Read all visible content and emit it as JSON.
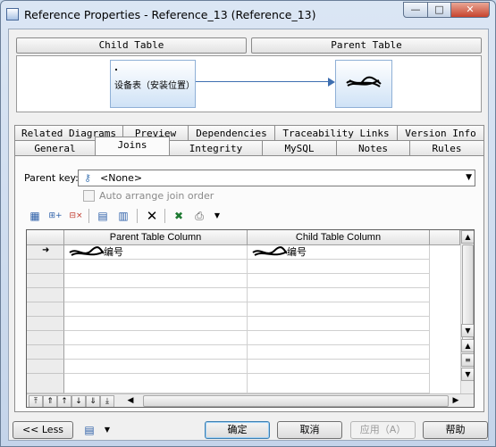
{
  "window": {
    "title": "Reference Properties - Reference_13 (Reference_13)",
    "controls": {
      "minimize": "—",
      "maximize": "□",
      "close": "✕"
    }
  },
  "header_buttons": {
    "child_table": "Child Table",
    "parent_table": "Parent Table"
  },
  "diagram": {
    "child_entity_label": "设备表（安装位置）",
    "parent_entity_label": "",
    "line_color": "#3f6fb0"
  },
  "tabs": {
    "row_back": [
      "Related Diagrams",
      "Preview",
      "Dependencies",
      "Traceability Links",
      "Version Info"
    ],
    "row_front": [
      "General",
      "Joins",
      "Integrity",
      "MySQL",
      "Notes",
      "Rules"
    ],
    "active": "Joins"
  },
  "joins": {
    "parent_key_label": "Parent key:",
    "parent_key_value": "<None>",
    "auto_arrange_label": "Auto arrange join order",
    "auto_arrange_checked": false,
    "toolbar_icons": [
      "insert-row-icon",
      "add-row-icon",
      "delete-rows-icon",
      "reuse-columns-icon",
      "migrate-columns-icon",
      "delete-icon",
      "excel-export-icon",
      "print-icon",
      "dropdown-arrow-icon"
    ],
    "columns": [
      "Parent Table Column",
      "Child Table Column"
    ],
    "rows": [
      {
        "parent": "编号",
        "child": "编号",
        "current": true
      }
    ],
    "empty_rows": 9
  },
  "footer": {
    "less": "<< Less",
    "ok": "确定",
    "cancel": "取消",
    "apply": "应用（A）",
    "help": "帮助"
  },
  "colors": {
    "accent": "#3c7fb1",
    "window_frame": "#c4d4ea"
  }
}
